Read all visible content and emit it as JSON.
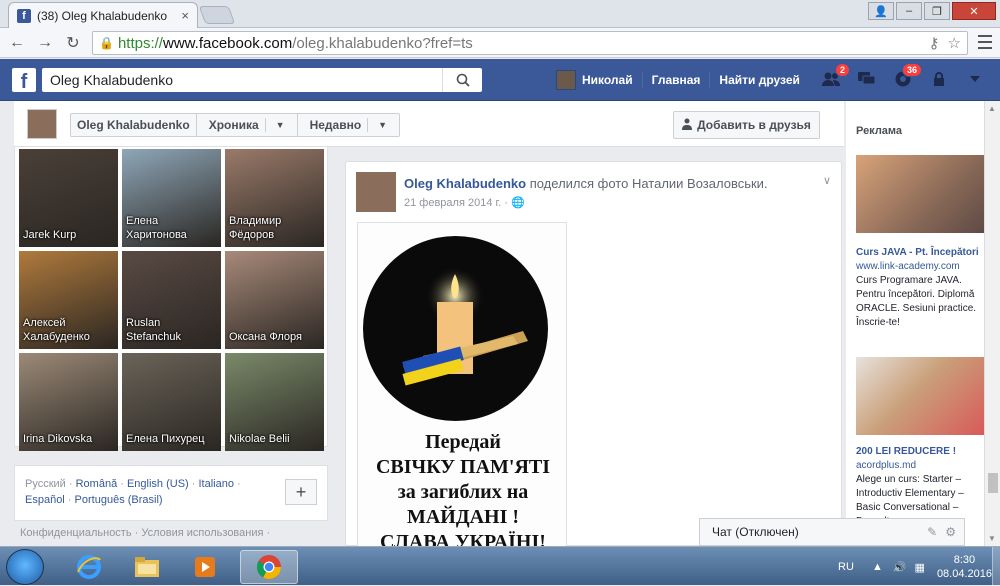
{
  "browser": {
    "tab_title": "(38) Oleg Khalabudenko",
    "favicon": "f",
    "url_scheme": "https://",
    "url_domain": "www.facebook.com",
    "url_path": "/oleg.khalabudenko?fref=ts",
    "tab_close": "×",
    "back": "←",
    "forward": "→",
    "reload": "↻",
    "win_min": "–",
    "win_max": "❐",
    "win_close": "✕"
  },
  "fb": {
    "logo": "f",
    "search_value": "Oleg Khalabudenko",
    "nav_user": "Николай",
    "nav_home": "Главная",
    "nav_find_friends": "Найти друзей",
    "friend_requests_badge": "2",
    "notifications_badge": "36"
  },
  "profile_header": {
    "name": "Oleg Khalabudenko",
    "timeline": "Хроника",
    "recent": "Недавно",
    "add_friend": "Добавить в друзья"
  },
  "friends": [
    {
      "name": "Jarek Kurp",
      "color": "#4a4038"
    },
    {
      "name": "Елена\nХаритонова",
      "color": "#8fa7b8"
    },
    {
      "name": "Владимир\nФёдоров",
      "color": "#9a7a6a"
    },
    {
      "name": "Алексей\nХалабуденко",
      "color": "#b07a3c"
    },
    {
      "name": "Ruslan\nStefanchuk",
      "color": "#5a4a44"
    },
    {
      "name": "Оксана Флоря",
      "color": "#a88a7a"
    },
    {
      "name": "Irina Dikovska",
      "color": "#9c8a78"
    },
    {
      "name": "Елена Пихурец",
      "color": "#6a6458"
    },
    {
      "name": "Nikolae Belii",
      "color": "#7a8a6a"
    }
  ],
  "languages": {
    "l1": "Русский",
    "l2": "Română",
    "l3": "English (US)",
    "l4": "Italiano",
    "l5": "Español",
    "l6": "Português (Brasil)",
    "plus": "+"
  },
  "footer_text": "Конфиденциальность · Условия использования ·",
  "post": {
    "author": "Oleg Khalabudenko",
    "action": "поделился фото Наталии Возаловськи.",
    "date": "21 февраля 2014 г. ·",
    "image_lines": [
      "Передай",
      "СВІЧКУ ПАМ'ЯТІ",
      "за загиблих на",
      "МАЙДАНІ !",
      "СЛАВА УКРАЇНІ!"
    ]
  },
  "ads": {
    "section_title": "Реклама",
    "ad1": {
      "title": "Curs JAVA - Pt. Începători",
      "url": "www.link-academy.com",
      "text": "Curs Programare JAVA. Pentru începători. Diplomă ORACLE. Sesiuni practice. Înscrie-te!"
    },
    "ad2": {
      "title": "200 LEI REDUCERE !",
      "url": "acordplus.md",
      "text": "Alege un curs: Starter – Introductiv Elementary – Basic Conversational – Dezvoltare"
    }
  },
  "chat": {
    "label": "Чат (Отключен)"
  },
  "taskbar": {
    "lang": "RU",
    "time": "8:30",
    "date": "08.04.2016"
  }
}
